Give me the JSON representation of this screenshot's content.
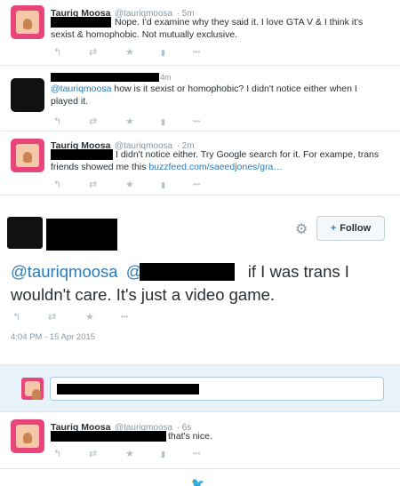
{
  "tweets": [
    {
      "name": "Tauriq Moosa",
      "handle": "@tauriqmoosa",
      "time": "· 5m",
      "line1": "Nope. I'd examine why they said it. I love GTA V & I think it's",
      "line2": "sexist & homophobic. Not mutually exclusive."
    },
    {
      "time": "4m",
      "mention": "@tauriqmoosa",
      "line1_rest": " how is it sexist or homophobic? I didn't notice either when I",
      "line2": "played it."
    },
    {
      "name": "Tauriq Moosa",
      "handle": "@tauriqmoosa",
      "time": "· 2m",
      "line1": "I didn't notice either. Try Google search for it. For exampe, trans",
      "line2_pre": "friends showed me this ",
      "link": "buzzfeed.com/saeedjones/gra…"
    }
  ],
  "focused": {
    "follow_label": "Follow",
    "mention": "@tauriqmoosa",
    "mention2": "@",
    "line1_rest": " if I was trans I",
    "line2": "wouldn't care. It's just a video game.",
    "timestamp": "4:04 PM - 15 Apr 2015"
  },
  "reply_tweet": {
    "name": "Tauriq Moosa",
    "handle": "@tauriqmoosa",
    "time": "· 6s",
    "text": "that's nice."
  },
  "icons": {
    "reply": "↰",
    "retweet": "⇄",
    "favorite": "★",
    "stats": "▮",
    "more": "•••",
    "gear": "⚙",
    "follow_plus": "+",
    "bird": "🐦"
  }
}
